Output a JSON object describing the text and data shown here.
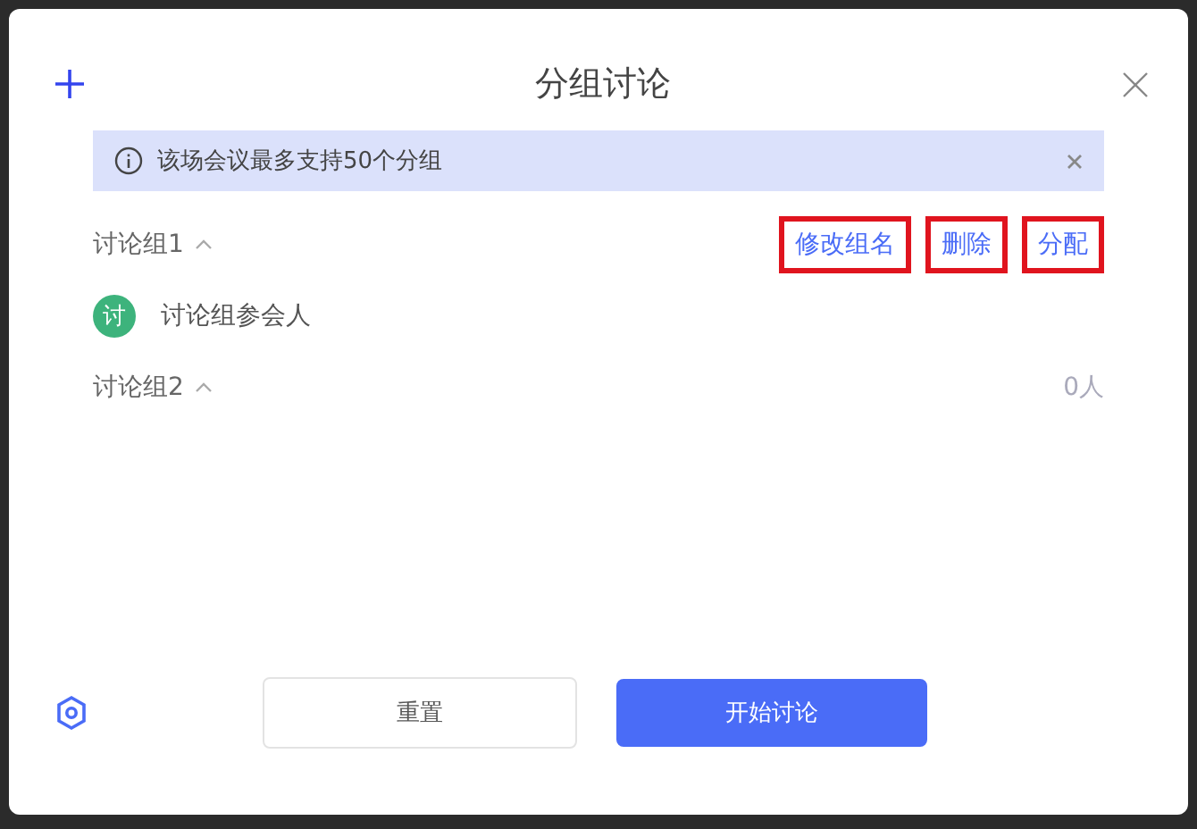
{
  "dialog": {
    "title": "分组讨论"
  },
  "notice": {
    "text": "该场会议最多支持50个分组"
  },
  "groups": [
    {
      "name": "讨论组1",
      "expanded": true,
      "actions": [
        {
          "label": "修改组名",
          "highlighted": true
        },
        {
          "label": "删除",
          "highlighted": true
        },
        {
          "label": "分配",
          "highlighted": true
        }
      ],
      "members": [
        {
          "avatar": "讨",
          "name": "讨论组参会人"
        }
      ]
    },
    {
      "name": "讨论组2",
      "expanded": true,
      "count": "0人"
    }
  ],
  "buttons": [
    {
      "label": "重置",
      "kind": "secondary"
    },
    {
      "label": "开始讨论",
      "kind": "primary"
    }
  ]
}
